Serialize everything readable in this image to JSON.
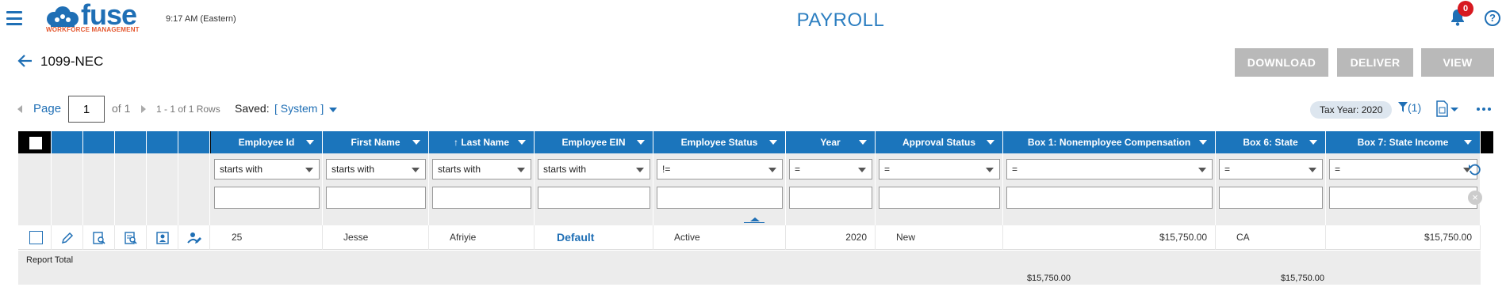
{
  "header": {
    "logo_word": "fuse",
    "logo_sub": "WORKFORCE MANAGEMENT",
    "clock": "9:17 AM (Eastern)",
    "app_title": "PAYROLL",
    "notification_count": "0",
    "help_symbol": "?"
  },
  "page": {
    "title": "1099-NEC",
    "actions": {
      "download": "DOWNLOAD",
      "deliver": "DELIVER",
      "view": "VIEW"
    }
  },
  "pager": {
    "page_label": "Page",
    "page_value": "1",
    "of_label": "of 1",
    "rows_label": "1 - 1 of 1 Rows",
    "saved_label": "Saved:",
    "saved_value": "[ System ]",
    "tax_year": "Tax Year: 2020",
    "filter_count": "(1)"
  },
  "columns": [
    {
      "key": "employee_id",
      "label": "Employee Id",
      "op": "starts with"
    },
    {
      "key": "first_name",
      "label": "First Name",
      "op": "starts with"
    },
    {
      "key": "last_name",
      "label": "Last Name",
      "op": "starts with",
      "sort": "asc"
    },
    {
      "key": "employee_ein",
      "label": "Employee EIN",
      "op": "starts with"
    },
    {
      "key": "employee_status",
      "label": "Employee Status",
      "op": "!="
    },
    {
      "key": "year",
      "label": "Year",
      "op": "="
    },
    {
      "key": "approval_status",
      "label": "Approval Status",
      "op": "="
    },
    {
      "key": "box1",
      "label": "Box 1: Nonemployee Compensation",
      "op": "="
    },
    {
      "key": "box6",
      "label": "Box 6: State",
      "op": "="
    },
    {
      "key": "box7",
      "label": "Box 7: State Income",
      "op": "="
    }
  ],
  "row": {
    "employee_id": "25",
    "first_name": "Jesse",
    "last_name": "Afriyie",
    "employee_ein": "Default",
    "employee_status": "Active",
    "year": "2020",
    "approval_status": "New",
    "box1": "$15,750.00",
    "box6": "CA",
    "box7": "$15,750.00"
  },
  "totals": {
    "label": "Report Total",
    "box1": "$15,750.00",
    "box7": "$15,750.00"
  },
  "colors": {
    "accent": "#1b75bc",
    "badge": "#d71920",
    "logo_sub": "#e4572e",
    "disabled_button": "#b9b9b9"
  }
}
